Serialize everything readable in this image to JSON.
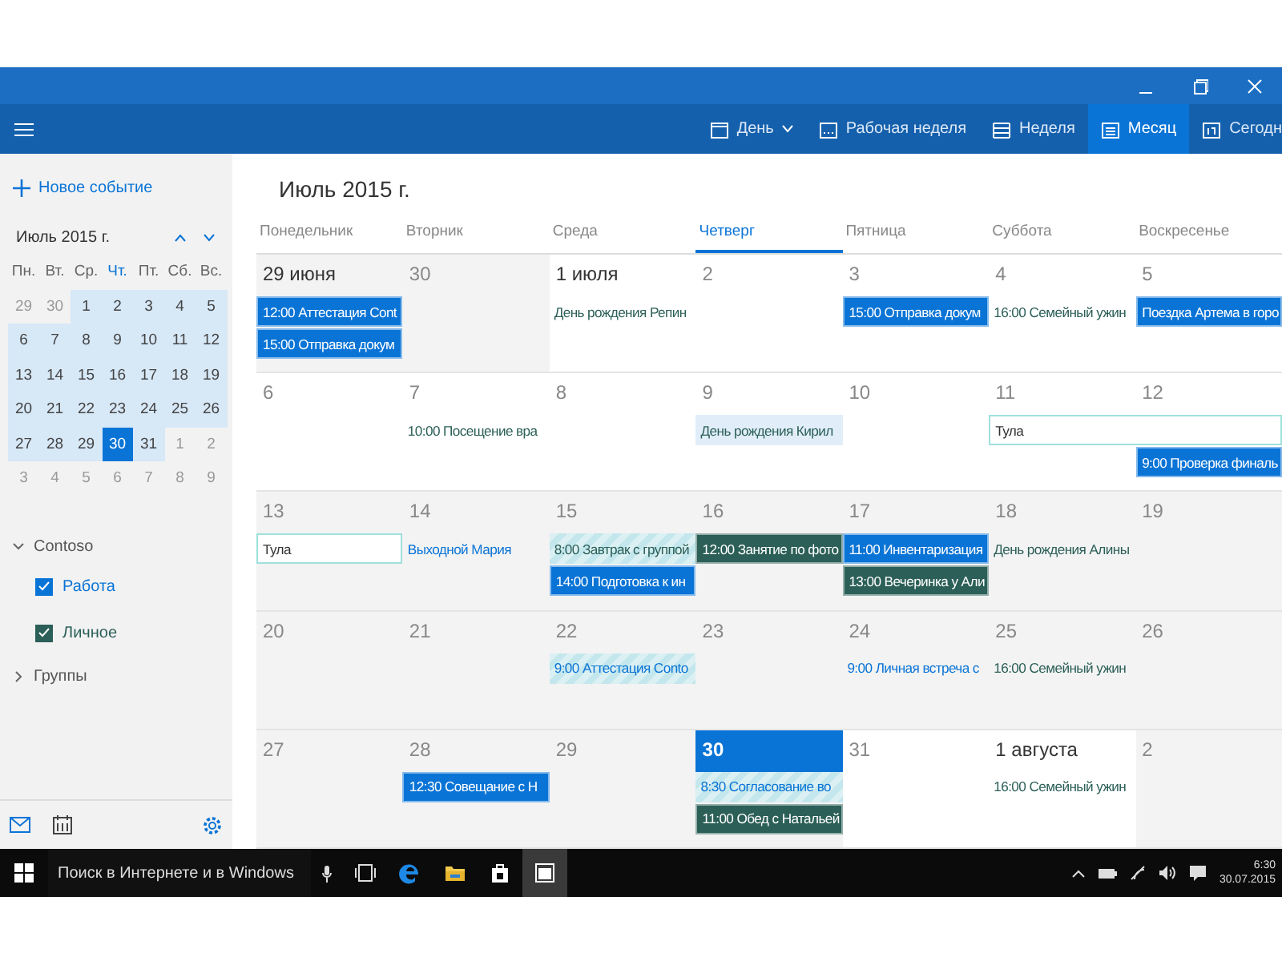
{
  "toolbar": {
    "items": [
      {
        "label": "День",
        "kind": "day",
        "dropdown": true,
        "selected": false
      },
      {
        "label": "Рабочая неделя",
        "kind": "workweek",
        "dropdown": false,
        "selected": false
      },
      {
        "label": "Неделя",
        "kind": "week",
        "dropdown": false,
        "selected": false
      },
      {
        "label": "Месяц",
        "kind": "month",
        "dropdown": false,
        "selected": true
      },
      {
        "label": "Сегодн",
        "kind": "today",
        "dropdown": false,
        "selected": false
      }
    ]
  },
  "sidebar": {
    "new_event": "Новое событие",
    "mini_calendar": {
      "title": "Июль 2015 г.",
      "weekdays": [
        {
          "label": "Пн.",
          "selected": false
        },
        {
          "label": "Вт.",
          "selected": false
        },
        {
          "label": "Ср.",
          "selected": false
        },
        {
          "label": "Чт.",
          "selected": true
        },
        {
          "label": "Пт.",
          "selected": false
        },
        {
          "label": "Сб.",
          "selected": false
        },
        {
          "label": "Вс.",
          "selected": false
        }
      ],
      "weeks": [
        [
          {
            "day": "29",
            "in_month": false,
            "selected": false
          },
          {
            "day": "30",
            "in_month": false,
            "selected": false
          },
          {
            "day": "1",
            "in_month": true,
            "selected": false
          },
          {
            "day": "2",
            "in_month": true,
            "selected": false
          },
          {
            "day": "3",
            "in_month": true,
            "selected": false
          },
          {
            "day": "4",
            "in_month": true,
            "selected": false
          },
          {
            "day": "5",
            "in_month": true,
            "selected": false
          }
        ],
        [
          {
            "day": "6",
            "in_month": true,
            "selected": false
          },
          {
            "day": "7",
            "in_month": true,
            "selected": false
          },
          {
            "day": "8",
            "in_month": true,
            "selected": false
          },
          {
            "day": "9",
            "in_month": true,
            "selected": false
          },
          {
            "day": "10",
            "in_month": true,
            "selected": false
          },
          {
            "day": "11",
            "in_month": true,
            "selected": false
          },
          {
            "day": "12",
            "in_month": true,
            "selected": false
          }
        ],
        [
          {
            "day": "13",
            "in_month": true,
            "selected": false
          },
          {
            "day": "14",
            "in_month": true,
            "selected": false
          },
          {
            "day": "15",
            "in_month": true,
            "selected": false
          },
          {
            "day": "16",
            "in_month": true,
            "selected": false
          },
          {
            "day": "17",
            "in_month": true,
            "selected": false
          },
          {
            "day": "18",
            "in_month": true,
            "selected": false
          },
          {
            "day": "19",
            "in_month": true,
            "selected": false
          }
        ],
        [
          {
            "day": "20",
            "in_month": true,
            "selected": false
          },
          {
            "day": "21",
            "in_month": true,
            "selected": false
          },
          {
            "day": "22",
            "in_month": true,
            "selected": false
          },
          {
            "day": "23",
            "in_month": true,
            "selected": false
          },
          {
            "day": "24",
            "in_month": true,
            "selected": false
          },
          {
            "day": "25",
            "in_month": true,
            "selected": false
          },
          {
            "day": "26",
            "in_month": true,
            "selected": false
          }
        ],
        [
          {
            "day": "27",
            "in_month": true,
            "selected": false
          },
          {
            "day": "28",
            "in_month": true,
            "selected": false
          },
          {
            "day": "29",
            "in_month": true,
            "selected": false
          },
          {
            "day": "30",
            "in_month": true,
            "selected": true
          },
          {
            "day": "31",
            "in_month": true,
            "selected": false
          },
          {
            "day": "1",
            "in_month": false,
            "selected": false
          },
          {
            "day": "2",
            "in_month": false,
            "selected": false
          }
        ],
        [
          {
            "day": "3",
            "in_month": false,
            "selected": false
          },
          {
            "day": "4",
            "in_month": false,
            "selected": false
          },
          {
            "day": "5",
            "in_month": false,
            "selected": false
          },
          {
            "day": "6",
            "in_month": false,
            "selected": false
          },
          {
            "day": "7",
            "in_month": false,
            "selected": false
          },
          {
            "day": "8",
            "in_month": false,
            "selected": false
          },
          {
            "day": "9",
            "in_month": false,
            "selected": false
          }
        ]
      ]
    },
    "accounts": [
      {
        "label": "Contoso",
        "expanded": true,
        "calendars": [
          {
            "label": "Работа",
            "checked": true,
            "color": "#0a74d6"
          },
          {
            "label": "Личное",
            "checked": true,
            "color": "#2b5f57"
          }
        ]
      },
      {
        "label": "Группы",
        "expanded": false
      }
    ]
  },
  "month": {
    "title": "Июль 2015 г.",
    "weekdays": [
      {
        "label": "Понедельник",
        "selected": false
      },
      {
        "label": "Вторник",
        "selected": false
      },
      {
        "label": "Среда",
        "selected": false
      },
      {
        "label": "Четверг",
        "selected": true
      },
      {
        "label": "Пятница",
        "selected": false
      },
      {
        "label": "Суббота",
        "selected": false
      },
      {
        "label": "Воскресенье",
        "selected": false
      }
    ],
    "weeks": [
      [
        {
          "label": "29 июня",
          "long": true,
          "shaded": true,
          "today": false,
          "events": [
            {
              "kind": "block",
              "color": "#0a74d6",
              "text": "12:00 Аттестация Cont"
            },
            {
              "kind": "block",
              "color": "#0a74d6",
              "text": "15:00 Отправка докум"
            }
          ]
        },
        {
          "label": "30",
          "long": false,
          "shaded": true,
          "today": false
        },
        {
          "label": "1 июля",
          "long": true,
          "shaded": false,
          "today": false,
          "events": [
            {
              "kind": "plain",
              "color": "#2b5f57",
              "text": "День рождения Репин"
            }
          ]
        },
        {
          "label": "2",
          "long": false,
          "shaded": false,
          "today": false
        },
        {
          "label": "3",
          "long": false,
          "shaded": false,
          "today": false,
          "events": [
            {
              "kind": "block",
              "color": "#0a74d6",
              "text": "15:00 Отправка докум"
            }
          ]
        },
        {
          "label": "4",
          "long": false,
          "shaded": false,
          "today": false,
          "events": [
            {
              "kind": "plain",
              "color": "#2b5f57",
              "text": "16:00 Семейный ужин"
            }
          ]
        },
        {
          "label": "5",
          "long": false,
          "shaded": false,
          "today": false,
          "events": [
            {
              "kind": "block",
              "color": "#0a74d6",
              "text": "Поездка Артема в горо"
            }
          ]
        }
      ],
      [
        {
          "label": "6",
          "long": false,
          "shaded": false,
          "today": false
        },
        {
          "label": "7",
          "long": false,
          "shaded": false,
          "today": false,
          "events": [
            {
              "kind": "plain",
              "color": "#2b5f57",
              "text": "10:00 Посещение вра"
            }
          ]
        },
        {
          "label": "8",
          "long": false,
          "shaded": false,
          "today": false
        },
        {
          "label": "9",
          "long": false,
          "shaded": false,
          "today": false,
          "events": [
            {
              "kind": "dotted",
              "color": "#2b5f57",
              "text": "День рождения Кирил"
            }
          ]
        },
        {
          "label": "10",
          "long": false,
          "shaded": false,
          "today": false
        },
        {
          "label": "11",
          "long": false,
          "shaded": false,
          "today": false,
          "events": [
            {
              "kind": "outline",
              "color": "#9fe0dc",
              "text": "Тула",
              "continues": true
            }
          ]
        },
        {
          "label": "12",
          "long": false,
          "shaded": false,
          "today": false,
          "events": [
            {
              "kind": "continuation",
              "color": "#9fe0dc"
            },
            {
              "kind": "block",
              "color": "#0a74d6",
              "text": "9:00 Проверка финаль"
            }
          ]
        }
      ],
      [
        {
          "label": "13",
          "long": false,
          "shaded": true,
          "today": false,
          "events": [
            {
              "kind": "outline",
              "color": "#9fe0dc",
              "text": "Тула",
              "continues": false
            }
          ]
        },
        {
          "label": "14",
          "long": false,
          "shaded": true,
          "today": false,
          "events": [
            {
              "kind": "plain",
              "color": "#0a74d6",
              "text": "Выходной Мария"
            }
          ]
        },
        {
          "label": "15",
          "long": false,
          "shaded": true,
          "today": false,
          "events": [
            {
              "kind": "striped",
              "color": "#2b5f57",
              "text": "8:00 Завтрак с группой"
            },
            {
              "kind": "block",
              "color": "#0a74d6",
              "text": "14:00 Подготовка к ин"
            }
          ]
        },
        {
          "label": "16",
          "long": false,
          "shaded": true,
          "today": false,
          "events": [
            {
              "kind": "block",
              "color": "#2b5f57",
              "text": "12:00 Занятие по фото"
            }
          ]
        },
        {
          "label": "17",
          "long": false,
          "shaded": true,
          "today": false,
          "events": [
            {
              "kind": "block",
              "color": "#0a74d6",
              "text": "11:00 Инвентаризация"
            },
            {
              "kind": "block",
              "color": "#2b5f57",
              "text": "13:00 Вечеринка у Али"
            }
          ]
        },
        {
          "label": "18",
          "long": false,
          "shaded": true,
          "today": false,
          "events": [
            {
              "kind": "plain",
              "color": "#2b5f57",
              "text": "День рождения Алины"
            }
          ]
        },
        {
          "label": "19",
          "long": false,
          "shaded": true,
          "today": false
        }
      ],
      [
        {
          "label": "20",
          "long": false,
          "shaded": true,
          "today": false
        },
        {
          "label": "21",
          "long": false,
          "shaded": true,
          "today": false
        },
        {
          "label": "22",
          "long": false,
          "shaded": true,
          "today": false,
          "events": [
            {
              "kind": "striped",
              "color": "#0a74d6",
              "text": "9:00 Аттестация Conto"
            }
          ]
        },
        {
          "label": "23",
          "long": false,
          "shaded": true,
          "today": false
        },
        {
          "label": "24",
          "long": false,
          "shaded": true,
          "today": false,
          "events": [
            {
              "kind": "plain",
              "color": "#0a74d6",
              "text": "9:00 Личная встреча с"
            }
          ]
        },
        {
          "label": "25",
          "long": false,
          "shaded": true,
          "today": false,
          "events": [
            {
              "kind": "plain",
              "color": "#2b5f57",
              "text": "16:00 Семейный ужин"
            }
          ]
        },
        {
          "label": "26",
          "long": false,
          "shaded": true,
          "today": false
        }
      ],
      [
        {
          "label": "27",
          "long": false,
          "shaded": true,
          "today": false
        },
        {
          "label": "28",
          "long": false,
          "shaded": true,
          "today": false,
          "events": [
            {
              "kind": "block",
              "color": "#0a74d6",
              "text": "12:30 Совещание с Н"
            }
          ]
        },
        {
          "label": "29",
          "long": false,
          "shaded": true,
          "today": false
        },
        {
          "label": "30",
          "long": false,
          "shaded": true,
          "today": true,
          "events": [
            {
              "kind": "striped",
              "color": "#0a74d6",
              "text": "8:30 Согласование во"
            },
            {
              "kind": "block",
              "color": "#2b5f57",
              "text": "11:00 Обед с Натальей"
            }
          ]
        },
        {
          "label": "31",
          "long": false,
          "shaded": false,
          "today": false
        },
        {
          "label": "1 августа",
          "long": true,
          "shaded": false,
          "today": false,
          "events": [
            {
              "kind": "plain",
              "color": "#2b5f57",
              "text": "16:00 Семейный ужин"
            }
          ]
        },
        {
          "label": "2",
          "long": false,
          "shaded": true,
          "today": false
        }
      ]
    ]
  },
  "taskbar": {
    "search": "Поиск в Интернете и в Windows",
    "apps": [
      {
        "kind": "taskview",
        "active": false
      },
      {
        "kind": "edge",
        "active": false
      },
      {
        "kind": "folder",
        "active": false
      },
      {
        "kind": "store",
        "active": false
      },
      {
        "kind": "calendar",
        "active": true
      }
    ],
    "time": "6:30",
    "date": "30.07.2015"
  }
}
